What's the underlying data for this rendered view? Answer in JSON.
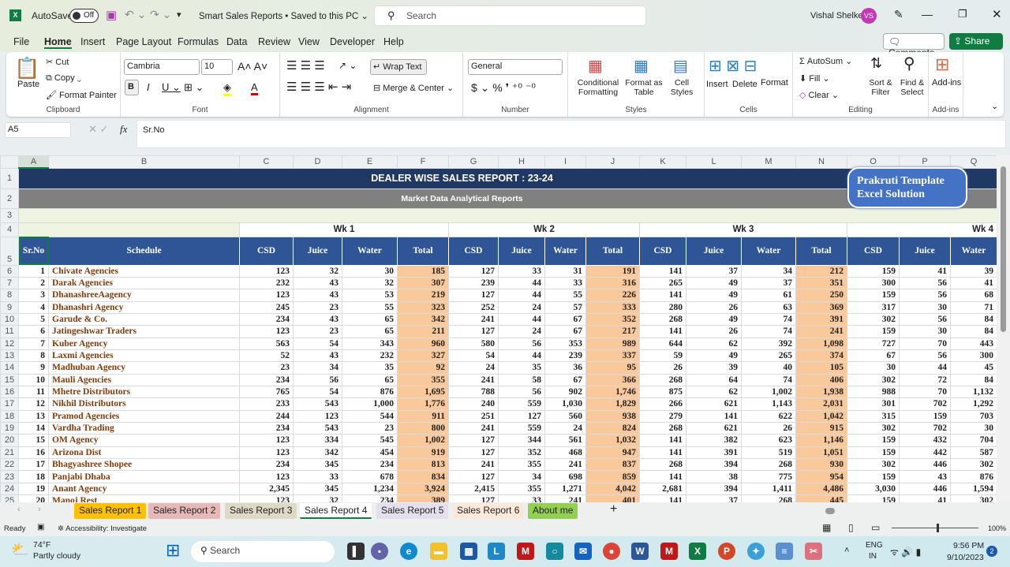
{
  "titlebar": {
    "autosave": "AutoSave",
    "toggle": "Off",
    "doc_title": "Smart Sales Reports • Saved to this PC ⌄",
    "search_placeholder": "Search",
    "user": "Vishal Shelke",
    "initials": "VS"
  },
  "menu": [
    "File",
    "Home",
    "Insert",
    "Page Layout",
    "Formulas",
    "Data",
    "Review",
    "View",
    "Developer",
    "Help"
  ],
  "comments": "Comments",
  "share": "Share",
  "ribbon": {
    "clipboard": {
      "paste": "Paste",
      "cut": "Cut",
      "copy": "Copy",
      "painter": "Format Painter",
      "label": "Clipboard"
    },
    "font": {
      "name": "Cambria",
      "size": "10",
      "label": "Font"
    },
    "alignment": {
      "wrap": "Wrap Text",
      "merge": "Merge & Center",
      "label": "Alignment"
    },
    "number": {
      "format": "General",
      "label": "Number"
    },
    "styles": {
      "cond": "Conditional Formatting",
      "table": "Format as Table",
      "cell": "Cell Styles",
      "label": "Styles"
    },
    "cells": {
      "insert": "Insert",
      "delete": "Delete",
      "format": "Format",
      "label": "Cells"
    },
    "editing": {
      "autosum": "AutoSum",
      "fill": "Fill",
      "clear": "Clear",
      "sort": "Sort & Filter",
      "find": "Find & Select",
      "label": "Editing"
    },
    "addins": {
      "addins": "Add-ins",
      "label": "Add-ins"
    }
  },
  "formula_bar": {
    "name_box": "A5",
    "fx": "fx",
    "value": "Sr.No"
  },
  "columns": [
    "A",
    "B",
    "C",
    "D",
    "E",
    "F",
    "G",
    "H",
    "I",
    "J",
    "K",
    "L",
    "M",
    "N",
    "O",
    "P",
    "Q"
  ],
  "sheet": {
    "title": "DEALER WISE SALES REPORT : 23-24",
    "subtitle": "Market Data Analytical Reports",
    "badge": "Prakruti Template Excel Solution",
    "weeks": [
      "Wk 1",
      "Wk 2",
      "Wk 3",
      "Wk 4"
    ],
    "headers": [
      "Sr.No",
      "Schedule",
      "CSD",
      "Juice",
      "Water",
      "Total",
      "CSD",
      "Juice",
      "Water",
      "Total",
      "CSD",
      "Juice",
      "Water",
      "Total",
      "CSD",
      "Juice",
      "Water"
    ],
    "rows": [
      [
        "1",
        "Chivate Agencies",
        "123",
        "32",
        "30",
        "185",
        "127",
        "33",
        "31",
        "191",
        "141",
        "37",
        "34",
        "212",
        "159",
        "41",
        "39"
      ],
      [
        "2",
        "Darak Agencies",
        "232",
        "43",
        "32",
        "307",
        "239",
        "44",
        "33",
        "316",
        "265",
        "49",
        "37",
        "351",
        "300",
        "56",
        "41"
      ],
      [
        "3",
        "DhanashreeAagency",
        "123",
        "43",
        "53",
        "219",
        "127",
        "44",
        "55",
        "226",
        "141",
        "49",
        "61",
        "250",
        "159",
        "56",
        "68"
      ],
      [
        "4",
        "Dhanashri Agency",
        "245",
        "23",
        "55",
        "323",
        "252",
        "24",
        "57",
        "333",
        "280",
        "26",
        "63",
        "369",
        "317",
        "30",
        "71"
      ],
      [
        "5",
        "Garude & Co.",
        "234",
        "43",
        "65",
        "342",
        "241",
        "44",
        "67",
        "352",
        "268",
        "49",
        "74",
        "391",
        "302",
        "56",
        "84"
      ],
      [
        "6",
        "Jatingeshwar Traders",
        "123",
        "23",
        "65",
        "211",
        "127",
        "24",
        "67",
        "217",
        "141",
        "26",
        "74",
        "241",
        "159",
        "30",
        "84"
      ],
      [
        "7",
        "Kuber Agency",
        "563",
        "54",
        "343",
        "960",
        "580",
        "56",
        "353",
        "989",
        "644",
        "62",
        "392",
        "1,098",
        "727",
        "70",
        "443"
      ],
      [
        "8",
        "Laxmi Agencies",
        "52",
        "43",
        "232",
        "327",
        "54",
        "44",
        "239",
        "337",
        "59",
        "49",
        "265",
        "374",
        "67",
        "56",
        "300"
      ],
      [
        "9",
        "Madhuban Agency",
        "23",
        "34",
        "35",
        "92",
        "24",
        "35",
        "36",
        "95",
        "26",
        "39",
        "40",
        "105",
        "30",
        "44",
        "45"
      ],
      [
        "10",
        "Mauli Agencies",
        "234",
        "56",
        "65",
        "355",
        "241",
        "58",
        "67",
        "366",
        "268",
        "64",
        "74",
        "406",
        "302",
        "72",
        "84"
      ],
      [
        "11",
        "Mhetre Distributors",
        "765",
        "54",
        "876",
        "1,695",
        "788",
        "56",
        "902",
        "1,746",
        "875",
        "62",
        "1,002",
        "1,938",
        "988",
        "70",
        "1,132"
      ],
      [
        "12",
        "Nikhil Distributors",
        "233",
        "543",
        "1,000",
        "1,776",
        "240",
        "559",
        "1,030",
        "1,829",
        "266",
        "621",
        "1,143",
        "2,031",
        "301",
        "702",
        "1,292"
      ],
      [
        "13",
        "Pramod Agencies",
        "244",
        "123",
        "544",
        "911",
        "251",
        "127",
        "560",
        "938",
        "279",
        "141",
        "622",
        "1,042",
        "315",
        "159",
        "703"
      ],
      [
        "14",
        "Vardha Trading",
        "234",
        "543",
        "23",
        "800",
        "241",
        "559",
        "24",
        "824",
        "268",
        "621",
        "26",
        "915",
        "302",
        "702",
        "30"
      ],
      [
        "15",
        "OM Agency",
        "123",
        "334",
        "545",
        "1,002",
        "127",
        "344",
        "561",
        "1,032",
        "141",
        "382",
        "623",
        "1,146",
        "159",
        "432",
        "704"
      ],
      [
        "16",
        "Arizona Dist",
        "123",
        "342",
        "454",
        "919",
        "127",
        "352",
        "468",
        "947",
        "141",
        "391",
        "519",
        "1,051",
        "159",
        "442",
        "587"
      ],
      [
        "17",
        "Bhagyashree Shopee",
        "234",
        "345",
        "234",
        "813",
        "241",
        "355",
        "241",
        "837",
        "268",
        "394",
        "268",
        "930",
        "302",
        "446",
        "302"
      ],
      [
        "18",
        "Panjabi Dhaba",
        "123",
        "33",
        "678",
        "834",
        "127",
        "34",
        "698",
        "859",
        "141",
        "38",
        "775",
        "954",
        "159",
        "43",
        "876"
      ],
      [
        "19",
        "Anant Agency",
        "2,345",
        "345",
        "1,234",
        "3,924",
        "2,415",
        "355",
        "1,271",
        "4,042",
        "2,681",
        "394",
        "1,411",
        "4,486",
        "3,030",
        "446",
        "1,594"
      ],
      [
        "20",
        "Manoj Rest",
        "123",
        "32",
        "234",
        "389",
        "127",
        "33",
        "241",
        "401",
        "141",
        "37",
        "268",
        "445",
        "159",
        "41",
        "302"
      ]
    ]
  },
  "sheet_tabs": [
    {
      "label": "Sales Report 1",
      "color": "#ffc000"
    },
    {
      "label": "Sales Report 2",
      "color": "#e6b8b7"
    },
    {
      "label": "Sales Report 3",
      "color": "#ddd9c4"
    },
    {
      "label": "Sales Report 4",
      "color": "#ffffff"
    },
    {
      "label": "Sales Report 5",
      "color": "#e4dfec"
    },
    {
      "label": "Sales Report 6",
      "color": "#fde9d9"
    },
    {
      "label": "About me",
      "color": "#92d050"
    }
  ],
  "status": {
    "ready": "Ready",
    "accessibility": "Accessibility: Investigate",
    "zoom": "100%"
  },
  "taskbar": {
    "temp": "74°F",
    "weather": "Partly cloudy",
    "search": "Search",
    "lang1": "ENG",
    "lang2": "IN",
    "time": "9:56 PM",
    "date": "9/10/2023",
    "badge": "2"
  },
  "colors": {
    "title_band": "#203864",
    "header": "#2f5597",
    "total": "#f9c89b",
    "name_text": "#843c0c",
    "share": "#107c41"
  }
}
